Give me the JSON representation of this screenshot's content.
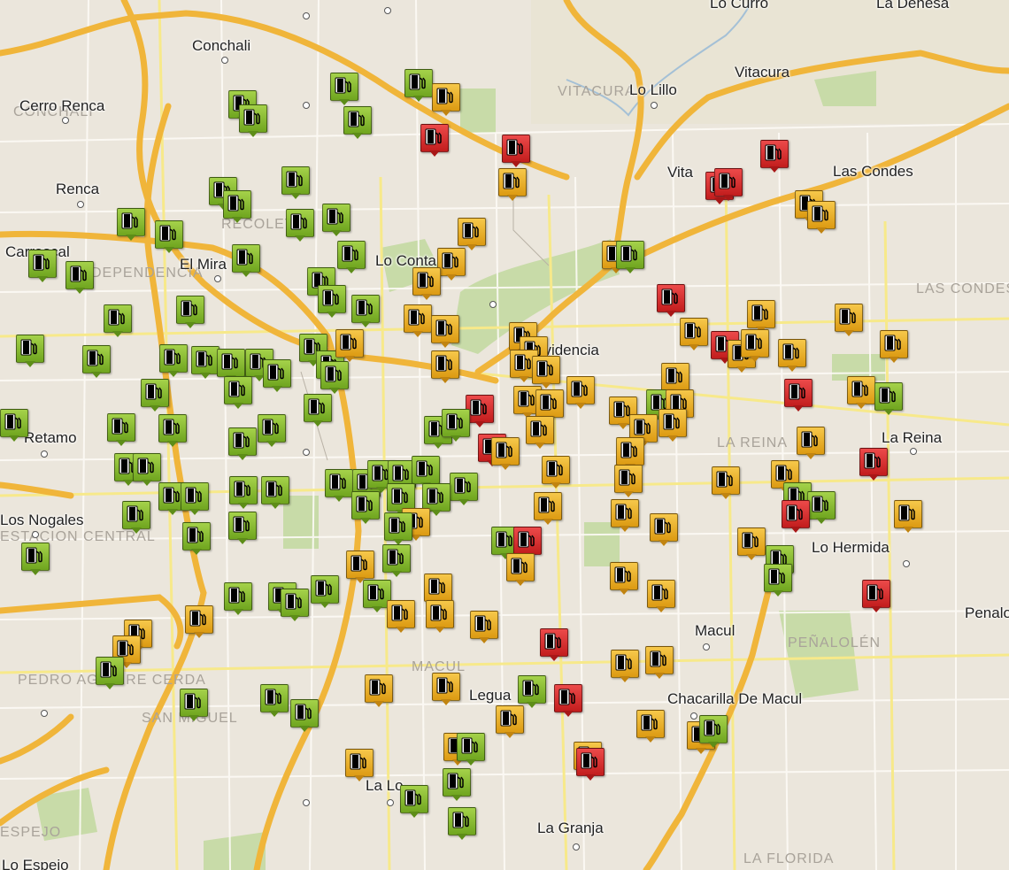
{
  "colors": {
    "green": "#8bc034",
    "yellow": "#eab22d",
    "red": "#d83131",
    "road": "#f0b53a",
    "park": "#c8dba8"
  },
  "icons": {
    "marker": "gas-pump-icon"
  },
  "labels": {
    "lo_curro": "Lo Curro",
    "la_dehesa": "La Dehesa",
    "conchali": "Conchali",
    "vitacura": "Vitacura",
    "lo_lillo": "Lo Lillo",
    "cerro_renca": "Cerro Renca",
    "las_condes": "Las Condes",
    "renca": "Renca",
    "vita": "Vita",
    "el_mira": "El Mira",
    "lo_conta": "Lo Conta",
    "carrascal": "Carrascal",
    "providencia": "Providencia",
    "el_retamo": "Retamo",
    "la_reina": "La Reina",
    "los_nogales": "Los Nogales",
    "lo_hermida": "Lo Hermida",
    "macul": "Macul",
    "penalolen": "Penalo",
    "legua": "Legua",
    "chacarilla": "Chacarilla De Macul",
    "la_granja": "La Granja",
    "la_lo": "La Lo",
    "lo_espejo": "Lo Espejo"
  },
  "districts": {
    "conchali": "CONCHALI",
    "vitacura": "VITACURA",
    "independencia": "INDEPENDENCIA",
    "las_condes": "LAS CONDES",
    "la_reina": "LA REINA",
    "estacion_central": "ESTACION CENTRAL",
    "penalolen": "PEÑALOLÉN",
    "pedro_aguirre_cerda": "PEDRO AGUIRRE CERDA",
    "san_miguel": "SAN MIGUEL",
    "macul": "MACUL",
    "espejo": "ESPEJO",
    "la_florida": "LA FLORIDA",
    "recoleta": "RECOLETA"
  },
  "stations": [
    {
      "type": "green",
      "price": "low"
    },
    {
      "type": "green",
      "price": "low"
    },
    {
      "type": "green",
      "price": "low"
    }
  ]
}
